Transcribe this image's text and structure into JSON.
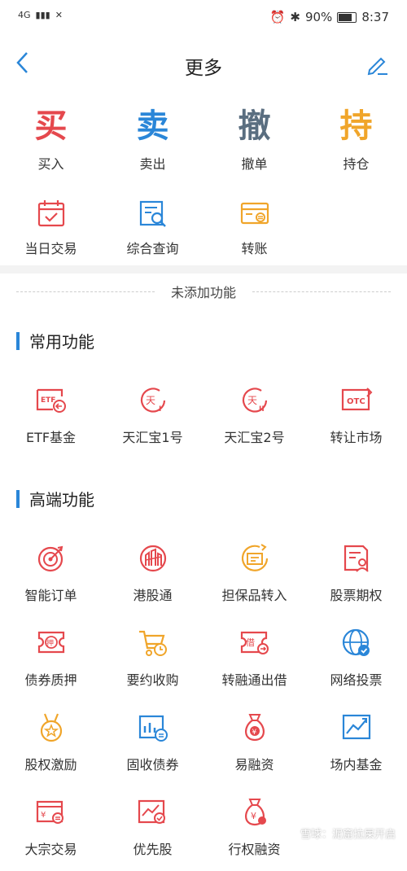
{
  "status_bar": {
    "left_text": "4G",
    "battery": "90%",
    "time": "8:37"
  },
  "header": {
    "title": "更多"
  },
  "quick": [
    {
      "char": "买",
      "label": "买入",
      "color": "#e5484d"
    },
    {
      "char": "卖",
      "label": "卖出",
      "color": "#2a86d8"
    },
    {
      "char": "撤",
      "label": "撤单",
      "color": "#5a6e80"
    },
    {
      "char": "持",
      "label": "持仓",
      "color": "#f0a52a"
    }
  ],
  "quick_row2": [
    {
      "label": "当日交易",
      "icon": "calendar-check-icon"
    },
    {
      "label": "综合查询",
      "icon": "search-doc-icon"
    },
    {
      "label": "转账",
      "icon": "card-transfer-icon"
    }
  ],
  "unadded_label": "未添加功能",
  "common": {
    "title": "常用功能",
    "items": [
      {
        "label": "ETF基金",
        "icon": "etf-icon"
      },
      {
        "label": "天汇宝1号",
        "icon": "tianhui1-icon"
      },
      {
        "label": "天汇宝2号",
        "icon": "tianhui2-icon"
      },
      {
        "label": "转让市场",
        "icon": "otc-icon"
      }
    ]
  },
  "advanced": {
    "title": "高端功能",
    "items": [
      {
        "label": "智能订单",
        "icon": "target-icon"
      },
      {
        "label": "港股通",
        "icon": "hk-stock-icon"
      },
      {
        "label": "担保品转入",
        "icon": "collateral-icon"
      },
      {
        "label": "股票期权",
        "icon": "option-icon"
      },
      {
        "label": "债券质押",
        "icon": "bond-pledge-icon"
      },
      {
        "label": "要约收购",
        "icon": "cart-icon"
      },
      {
        "label": "转融通出借",
        "icon": "lend-icon"
      },
      {
        "label": "网络投票",
        "icon": "globe-vote-icon"
      },
      {
        "label": "股权激励",
        "icon": "medal-icon"
      },
      {
        "label": "固收债券",
        "icon": "fixed-income-icon"
      },
      {
        "label": "易融资",
        "icon": "money-bag-icon"
      },
      {
        "label": "场内基金",
        "icon": "fund-chart-icon"
      },
      {
        "label": "大宗交易",
        "icon": "block-trade-icon"
      },
      {
        "label": "优先股",
        "icon": "preferred-icon"
      },
      {
        "label": "行权融资",
        "icon": "exercise-finance-icon"
      }
    ]
  },
  "watermark": "雪球：泥窟拉屎开启"
}
